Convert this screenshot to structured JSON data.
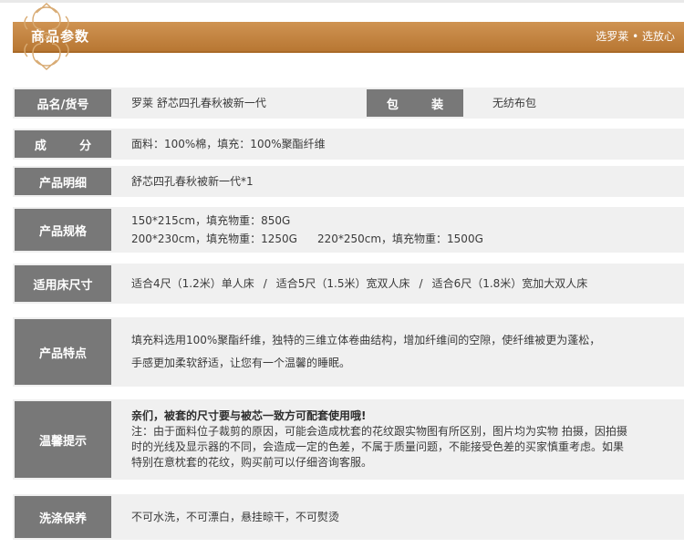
{
  "header": {
    "title": "商品参数",
    "slogan": "选罗莱 • 选放心"
  },
  "rows": {
    "model": {
      "label": "品名/货号",
      "value": "罗莱  舒芯四孔春秋被新一代",
      "label2": "包        装",
      "value2": "无纺布包"
    },
    "composition": {
      "label": "成        分",
      "value": "面料：100%棉，填充：100%聚酯纤维"
    },
    "detail": {
      "label": "产品明细",
      "value": "舒芯四孔春秋被新一代*1"
    },
    "spec": {
      "label": "产品规格",
      "line1": "150*215cm，填充物重：850G",
      "line2a": "200*230cm，填充物重：1250G",
      "line2b": "220*250cm，填充物重：1500G"
    },
    "bed": {
      "label": "适用床尺寸",
      "item1": "适合4尺（1.2米）单人床",
      "item2": "适合5尺（1.5米）宽双人床",
      "item3": "适合6尺（1.8米）宽加大双人床",
      "separator": "/"
    },
    "features": {
      "label": "产品特点",
      "line1": "填充料选用100%聚酯纤维，独特的三维立体卷曲结构，增加纤维间的空隙，使纤维被更为蓬松，",
      "line2": "手感更加柔软舒适，让您有一个温馨的睡眠。"
    },
    "tips": {
      "label": "温馨提示",
      "line1": "亲们，被套的尺寸要与被芯一致方可配套使用哦!",
      "line2": "注：由于面料位子裁剪的原因，可能会造成枕套的花纹跟实物图有所区别，图片均为实物 拍摄，因拍摄",
      "line3": "时的光线及显示器的不同，会造成一定的色差，不属于质量问题，不能接受色差的买家慎重考虑。如果",
      "line4": "特别在意枕套的花纹，购买前可以仔细咨询客服。"
    },
    "care": {
      "label": "洗涤保养",
      "value": "不可水洗，不可漂白，悬挂晾干，不可熨烫"
    }
  },
  "colors": {
    "banner": "#c4843f",
    "label_bg": "#787878",
    "row_bg": "#f0f0f0"
  }
}
